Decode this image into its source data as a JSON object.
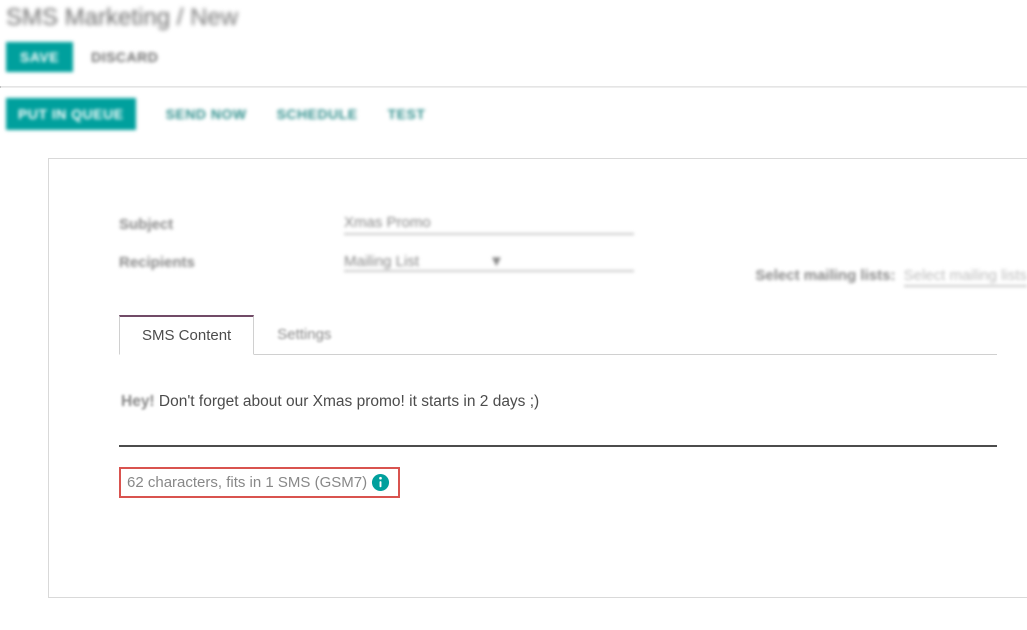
{
  "breadcrumb": {
    "root": "SMS Marketing",
    "sep": "/",
    "current": "New"
  },
  "actions": {
    "save": "SAVE",
    "discard": "DISCARD",
    "put_in_queue": "PUT IN QUEUE",
    "send_now": "SEND NOW",
    "schedule": "SCHEDULE",
    "test": "TEST"
  },
  "form": {
    "subject_label": "Subject",
    "subject_value": "Xmas Promo",
    "recipients_label": "Recipients",
    "recipients_value": "Mailing List",
    "mailing_list_label": "Select mailing lists:",
    "mailing_list_placeholder": "Select mailing lists"
  },
  "tabs": {
    "content": "SMS Content",
    "settings": "Settings"
  },
  "sms": {
    "prefix": "Hey!",
    "body": " Don't forget about our Xmas promo! it starts in 2 days ;)",
    "counter": "62 characters, fits in 1 SMS (GSM7)"
  }
}
